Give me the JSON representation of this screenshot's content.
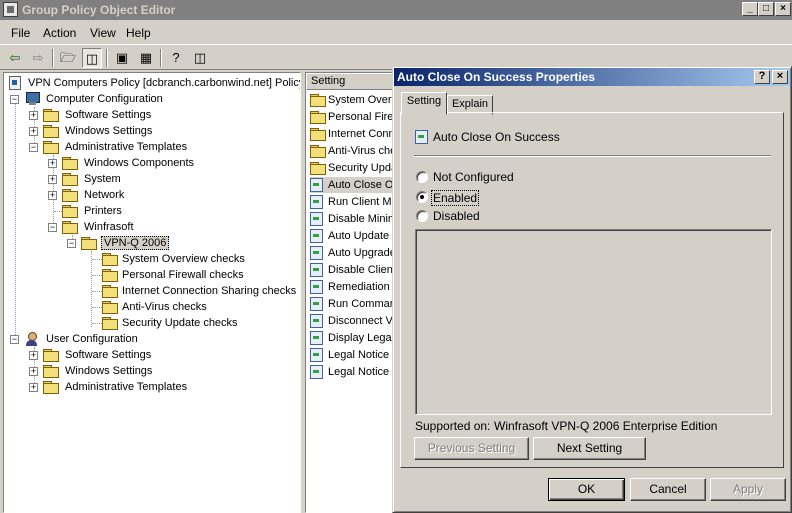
{
  "window": {
    "title": "Group Policy Object Editor",
    "min": "_",
    "max": "□",
    "close": "×"
  },
  "menu": [
    "File",
    "Action",
    "View",
    "Help"
  ],
  "tree": {
    "root": "VPN Computers Policy [dcbranch.carbonwind.net] Policy",
    "computer_config": "Computer Configuration",
    "software_settings": "Software Settings",
    "windows_settings": "Windows Settings",
    "admin_templates": "Administrative Templates",
    "windows_components": "Windows Components",
    "system": "System",
    "network": "Network",
    "printers": "Printers",
    "winfrasoft": "Winfrasoft",
    "vpnq": "VPN-Q 2006",
    "vpnq_children": [
      "System Overview checks",
      "Personal Firewall checks",
      "Internet Connection Sharing checks",
      "Anti-Virus checks",
      "Security Update checks"
    ],
    "user_config": "User Configuration",
    "user_software_settings": "Software Settings",
    "user_windows_settings": "Windows Settings",
    "user_admin_templates": "Administrative Templates"
  },
  "list": {
    "column": "Setting",
    "folders": [
      "System Overv",
      "Personal Firev",
      "Internet Conn",
      "Anti-Virus che",
      "Security Upda"
    ],
    "settings": [
      "Auto Close O",
      "Run Client Mi",
      "Disable Minim",
      "Auto Update",
      "Auto Upgrade",
      "Disable Client",
      "Remediation",
      "Run Comman",
      "Disconnect VF",
      "Display Legal",
      "Legal Notice n",
      "Legal Notice n"
    ]
  },
  "dialog": {
    "title": "Auto Close On Success Properties",
    "help": "?",
    "close": "×",
    "tabs": [
      "Setting",
      "Explain"
    ],
    "policy_name": "Auto Close On Success",
    "options": [
      "Not Configured",
      "Enabled",
      "Disabled"
    ],
    "selected_option": "Enabled",
    "supported_label": "Supported on:",
    "supported_value": "Winfrasoft VPN-Q 2006 Enterprise Edition",
    "prev_button": "Previous Setting",
    "next_button": "Next Setting",
    "ok": "OK",
    "cancel": "Cancel",
    "apply": "Apply"
  }
}
